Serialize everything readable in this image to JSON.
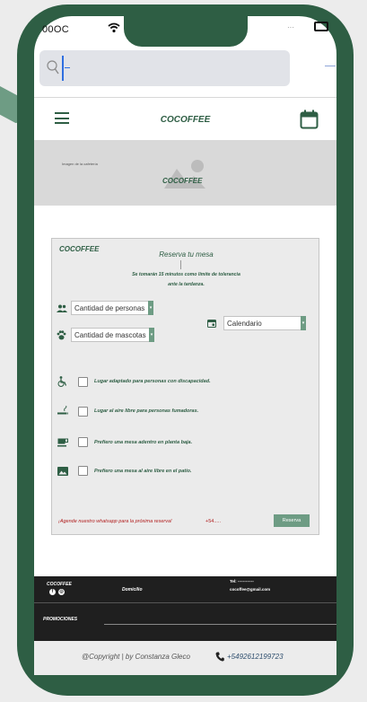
{
  "status_bar": {
    "time": "00OC",
    "extra": "···"
  },
  "topbar": {
    "brand": "COCOFFEE"
  },
  "cover": {
    "caption": "Imagen de la cafetería",
    "brand": "COCOFFEE"
  },
  "form": {
    "brand": "COCOFFEE",
    "title": "Reserva tu mesa",
    "note_line1": "Se tomarán 15 minutos como límite de tolerancia",
    "note_line2": "ante la tardanza.",
    "people_select": "Cantidad de personas",
    "pets_select": "Cantidad de mascotas",
    "calendar_select": "Calendario",
    "options": [
      {
        "label": "Lugar adaptado para personas con discapacidad.",
        "icon": "accessible-icon"
      },
      {
        "label": "Lugar al aire libre para personas fumadoras.",
        "icon": "smoking-icon"
      },
      {
        "label": "Prefiero una mesa adentro en planta baja.",
        "icon": "coffee-icon"
      },
      {
        "label": "Prefiero una mesa al aire libre en el patio.",
        "icon": "landscape-icon"
      }
    ],
    "footer_note": "¡Agende nuestro whatsapp para la próxima reserva!",
    "footer_phone": "+54.....",
    "submit": "Reserva"
  },
  "footer": {
    "brand": "COCOFFEE",
    "domicilio": "Domicilio",
    "tel": "Tel: ------------",
    "mail": "cocoffee@gmail.com",
    "promociones": "PROMOCIONES"
  },
  "bottom": {
    "copyright": "@Copyright | by Constanza Gleco",
    "phone": "+5492612199723"
  },
  "colors": {
    "brand_green": "#2e5e44",
    "accent_green": "#6e9c84",
    "warning_red": "#b01c1c"
  }
}
